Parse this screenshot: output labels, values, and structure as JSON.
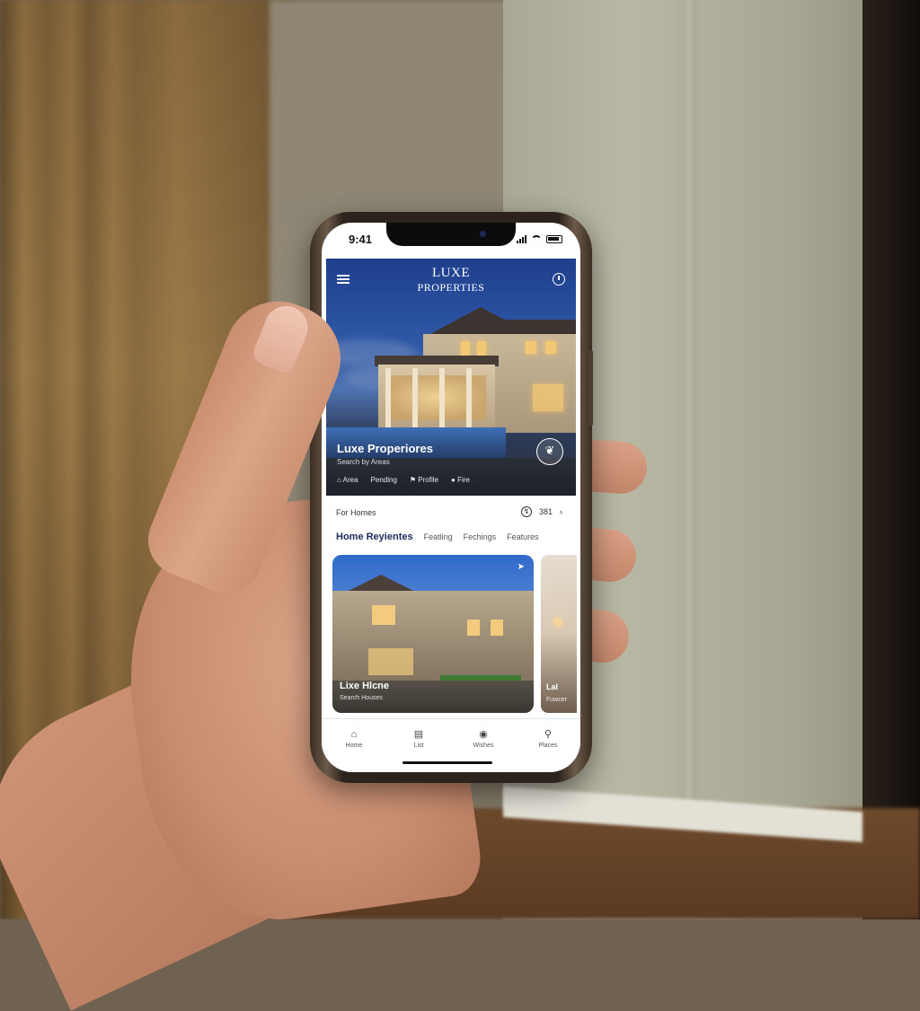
{
  "status_bar": {
    "time": "9:41"
  },
  "hero": {
    "brand_line1": "LUXE",
    "brand_line2": "PROPERTIES",
    "listing_name": "Luxe Properiores",
    "listing_sub": "Search by Areas",
    "chips": [
      {
        "icon": "home-icon",
        "label": "Area"
      },
      {
        "icon": "pin-icon",
        "label": "Pending"
      },
      {
        "icon": "tag-icon",
        "label": "Profile"
      },
      {
        "icon": "bed-icon",
        "label": "Fire"
      }
    ],
    "fab_icon": "leaf-icon"
  },
  "section": {
    "label": "For Homes",
    "count": "381",
    "tabs": [
      "Home Reyientes",
      "Featling",
      "Fechings",
      "Features"
    ]
  },
  "cards": [
    {
      "name": "Lixe Hlcne",
      "sub": "Search Houses"
    },
    {
      "name": "Lal",
      "sub": "Fuwcer"
    }
  ],
  "bottom_nav": [
    {
      "icon": "home-icon",
      "label": "Home"
    },
    {
      "icon": "list-icon",
      "label": "List"
    },
    {
      "icon": "chat-icon",
      "label": "Wishes"
    },
    {
      "icon": "search-icon",
      "label": "Places"
    }
  ]
}
